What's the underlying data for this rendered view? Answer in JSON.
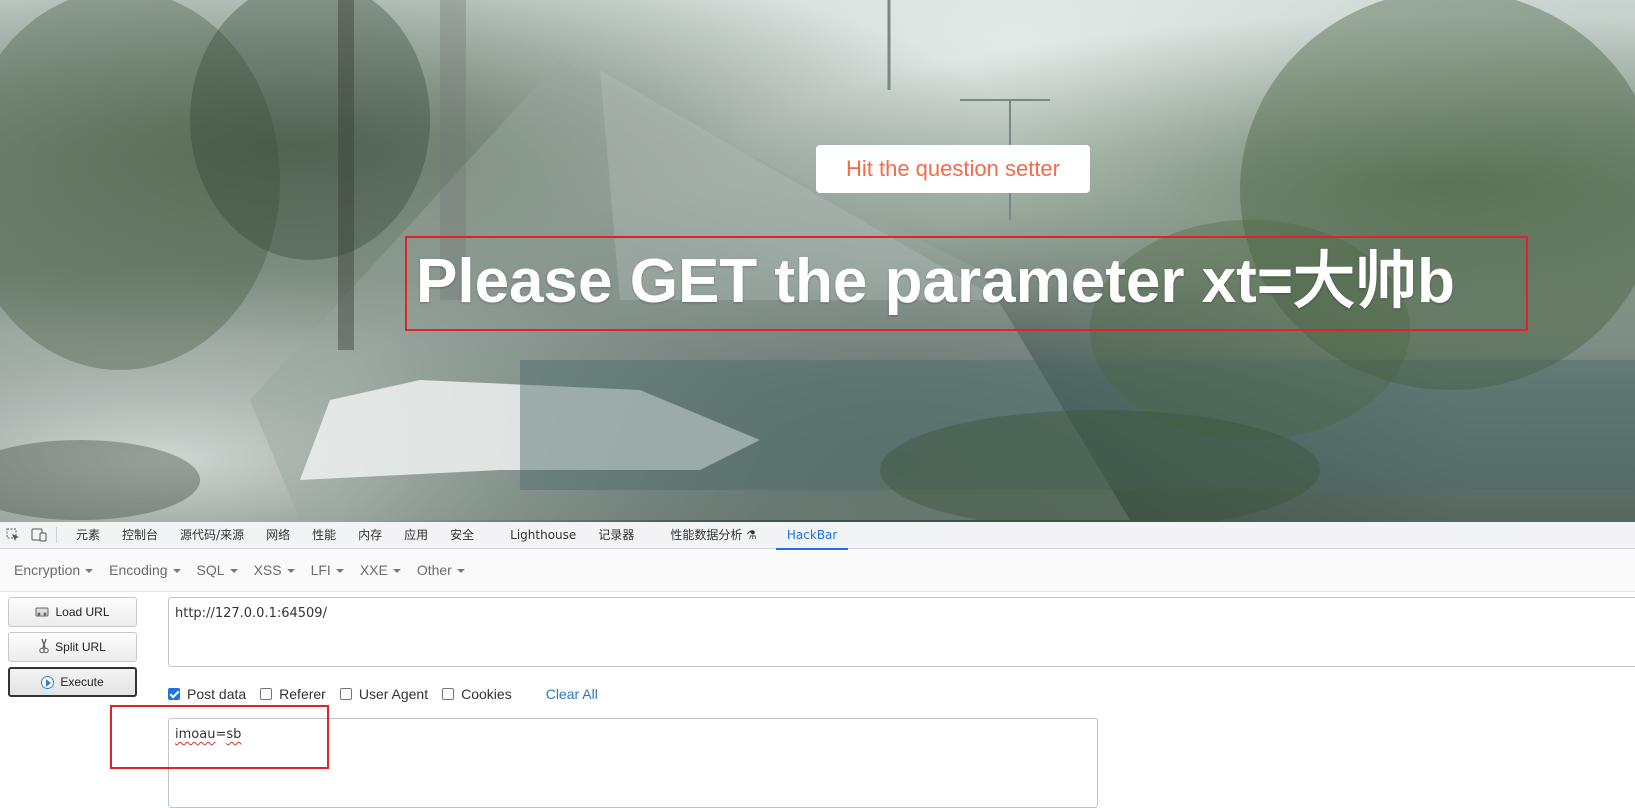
{
  "page": {
    "hit_button_label": "Hit the question setter",
    "main_message": "Please GET the parameter xt=大帅b"
  },
  "devtools": {
    "tabs": [
      {
        "label": "元素",
        "active": false
      },
      {
        "label": "控制台",
        "active": false
      },
      {
        "label": "源代码/来源",
        "active": false
      },
      {
        "label": "网络",
        "active": false
      },
      {
        "label": "性能",
        "active": false
      },
      {
        "label": "内存",
        "active": false
      },
      {
        "label": "应用",
        "active": false
      },
      {
        "label": "安全",
        "active": false
      },
      {
        "label": "Lighthouse",
        "active": false
      },
      {
        "label": "记录器",
        "active": false
      },
      {
        "label": "性能数据分析 ⚗",
        "active": false
      },
      {
        "label": "HackBar",
        "active": true
      }
    ],
    "icons": [
      "inspect-element-icon",
      "device-toolbar-icon"
    ]
  },
  "hackbar": {
    "menus": [
      "Encryption",
      "Encoding",
      "SQL",
      "XSS",
      "LFI",
      "XXE",
      "Other"
    ],
    "buttons": {
      "load_url": "Load URL",
      "split_url": "Split URL",
      "execute": "Execute"
    },
    "url_value": "http://127.0.0.1:64509/",
    "options": [
      {
        "label": "Post data",
        "checked": true
      },
      {
        "label": "Referer",
        "checked": false
      },
      {
        "label": "User Agent",
        "checked": false
      },
      {
        "label": "Cookies",
        "checked": false
      }
    ],
    "clear_all": "Clear All",
    "post_data_value_parts": [
      "imoau",
      "=",
      "sb"
    ],
    "accent_color": "#1a73e8",
    "annotation_color": "#e0232b"
  }
}
